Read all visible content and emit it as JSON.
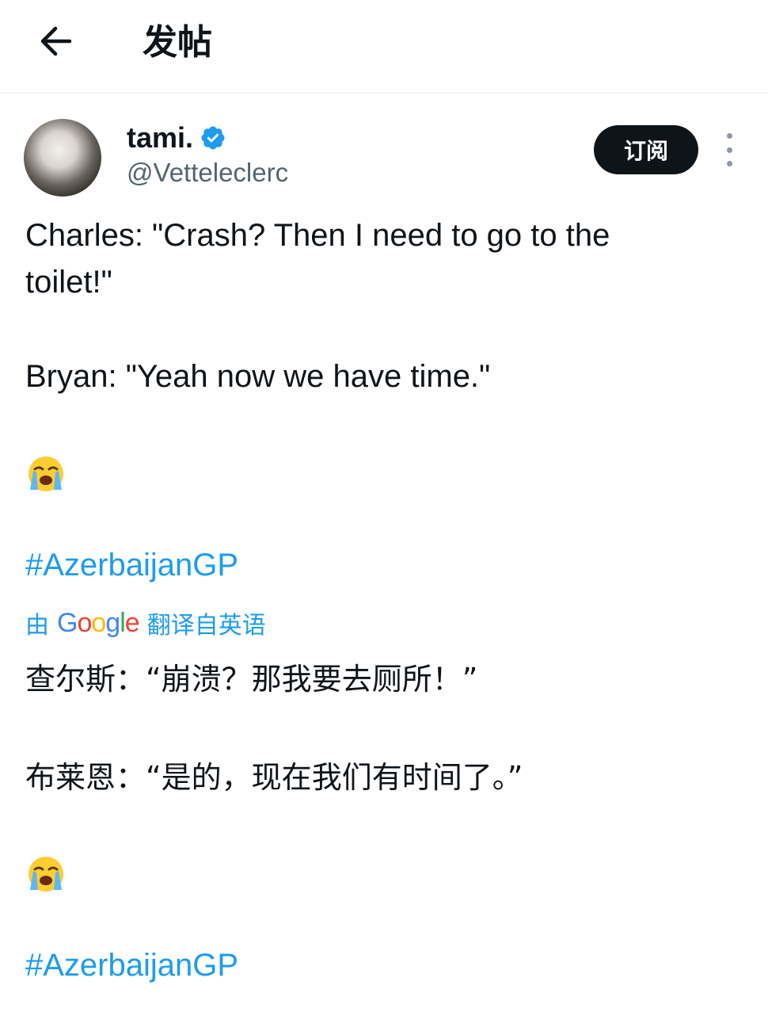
{
  "header": {
    "back_icon": "arrow-left-icon",
    "title": "发帖"
  },
  "tweet": {
    "author": {
      "display_name": "tami.",
      "handle": "@Vetteleclerc",
      "verified": true,
      "verified_color": "#1d9bf0"
    },
    "subscribe_label": "订阅",
    "more_icon": "more-vertical-icon",
    "original": {
      "line1": "Charles: \"Crash? Then I need to go to the",
      "line2": "toilet!\"",
      "line3": "Bryan: \"Yeah now we have time.\"",
      "emoji": "😭",
      "hashtag": "#AzerbaijanGP"
    },
    "translation": {
      "by_label": "由",
      "provider": "Google",
      "from_label": "翻译自英语",
      "line1": "查尔斯：“崩溃？那我要去厕所！”",
      "line2": "布莱恩：“是的，现在我们有时间了。”",
      "emoji": "😭",
      "hashtag": "#AzerbaijanGP"
    }
  },
  "colors": {
    "link": "#1d9bf0",
    "text": "#0f1419",
    "secondary": "#536471",
    "button_bg": "#0f1419"
  }
}
